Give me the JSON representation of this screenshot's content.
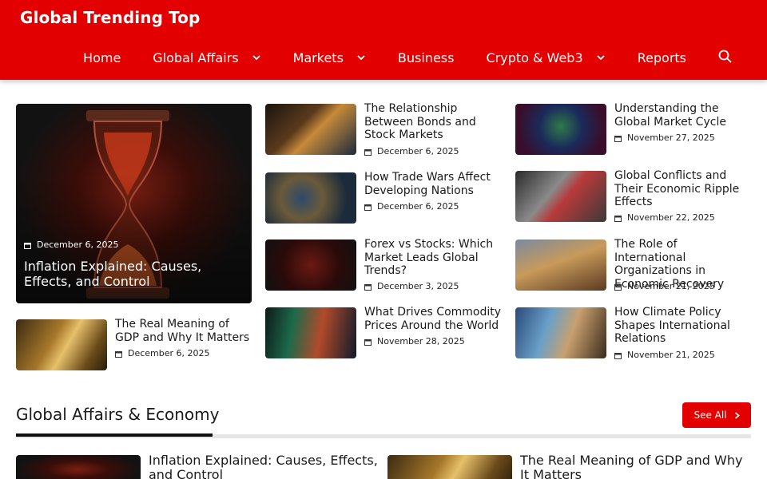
{
  "site": {
    "title": "Global Trending Top"
  },
  "nav": {
    "items": [
      {
        "label": "Home",
        "has_dropdown": false
      },
      {
        "label": "Global Affairs",
        "has_dropdown": true
      },
      {
        "label": "Markets",
        "has_dropdown": true
      },
      {
        "label": "Business",
        "has_dropdown": false
      },
      {
        "label": "Crypto & Web3",
        "has_dropdown": true
      },
      {
        "label": "Reports",
        "has_dropdown": false
      }
    ],
    "search_icon": "search-icon"
  },
  "hero": {
    "date": "December 6, 2025",
    "title": "Inflation Explained: Causes, Effects, and Control"
  },
  "left_card": {
    "title": "The Real Meaning of GDP and Why It Matters",
    "date": "December 6, 2025"
  },
  "middle_cards": [
    {
      "title": "The Relationship Between Bonds and Stock Markets",
      "date": "December 6, 2025"
    },
    {
      "title": "How Trade Wars Affect Developing Nations",
      "date": "December 6, 2025"
    },
    {
      "title": "Forex vs Stocks: Which Market Leads Global Trends?",
      "date": "December 3, 2025"
    },
    {
      "title": "What Drives Commodity Prices Around the World",
      "date": "November 28, 2025"
    }
  ],
  "right_cards": [
    {
      "title": "Understanding the Global Market Cycle",
      "date": "November 27, 2025"
    },
    {
      "title": "Global Conflicts and Their Economic Ripple Effects",
      "date": "November 22, 2025"
    },
    {
      "title": "The Role of International Organizations in Economic Recovery",
      "date": "November 21, 2025"
    },
    {
      "title": "How Climate Policy Shapes International Relations",
      "date": "November 21, 2025"
    }
  ],
  "section": {
    "title": "Global Affairs & Economy",
    "see_all": "See All",
    "items": [
      {
        "title": "Inflation Explained: Causes, Effects, and Control"
      },
      {
        "title": "The Real Meaning of GDP and Why It Matters"
      }
    ]
  },
  "colors": {
    "brand": "#e30000",
    "accent_dark": "#111111"
  }
}
